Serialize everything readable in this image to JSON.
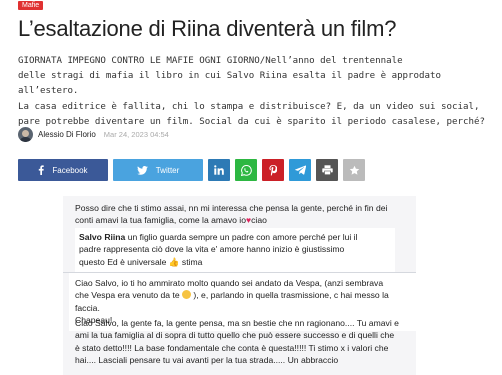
{
  "category": {
    "label": "Mafie"
  },
  "article": {
    "title": "L’esaltazione di Riina diventerà un film?",
    "lead_lines": [
      "GIORNATA IMPEGNO CONTRO LE MAFIE OGNI GIORNO/Nell’anno del trentennale",
      "delle stragi di mafia il libro in cui Salvo Riina esalta il padre è approdato all’estero.",
      "La casa editrice è fallita, chi lo stampa e distribuisce? E, da un video sui social,",
      "pare potrebbe diventare un film. Social da cui è sparito il periodo casalese, perché?"
    ],
    "author": "Alessio Di Florio",
    "date": "Mar 24, 2023 04:54"
  },
  "share": {
    "facebook": {
      "label": "Facebook",
      "icon": "facebook-icon"
    },
    "twitter": {
      "label": "Twitter",
      "icon": "twitter-icon"
    },
    "linkedin": {
      "icon": "linkedin-icon"
    },
    "whatsapp": {
      "icon": "whatsapp-icon"
    },
    "pinterest": {
      "icon": "pinterest-icon"
    },
    "telegram": {
      "icon": "telegram-icon"
    },
    "print": {
      "icon": "print-icon"
    },
    "favorite": {
      "icon": "star-icon"
    }
  },
  "comments": {
    "c1": {
      "lines": [
        "Posso dire che ti stimo assai, nn mi interessa che pensa la gente, perché in fin dei",
        "conti amavi la tua famiglia, come la amavo io",
        "ciao"
      ]
    },
    "c2": {
      "name": "Salvo Riina",
      "lines": [
        "un figlio guarda sempre un padre con amore perché per lui il",
        "padre rappresenta ciò dove la vita e' amore hanno inizio è giustissimo",
        "questo Ed è universale",
        "stima"
      ]
    },
    "c3": {
      "lines": [
        "Ciao Salvo, io ti ho ammirato molto quando sei andato da Vespa, (anzi sembrava",
        "che Vespa era venuto da te",
        "), e, parlando in quella trasmissione, c hai messo la",
        "faccia.",
        "Chapeau!"
      ]
    },
    "c4": {
      "lines": [
        "Ciao Salvo, la gente fa, la gente pensa, ma sn bestie che nn ragionano.... Tu amavi e",
        "ami la tua famiglia al di sopra di tutto quello che può essere successo e di quelli che",
        "è stato detto!!!! La base fondamentale che conta è questa!!!!! Ti stimo x i valori che",
        "hai.... Lasciali pensare tu vai avanti per la tua strada..... Un abbraccio"
      ]
    }
  }
}
